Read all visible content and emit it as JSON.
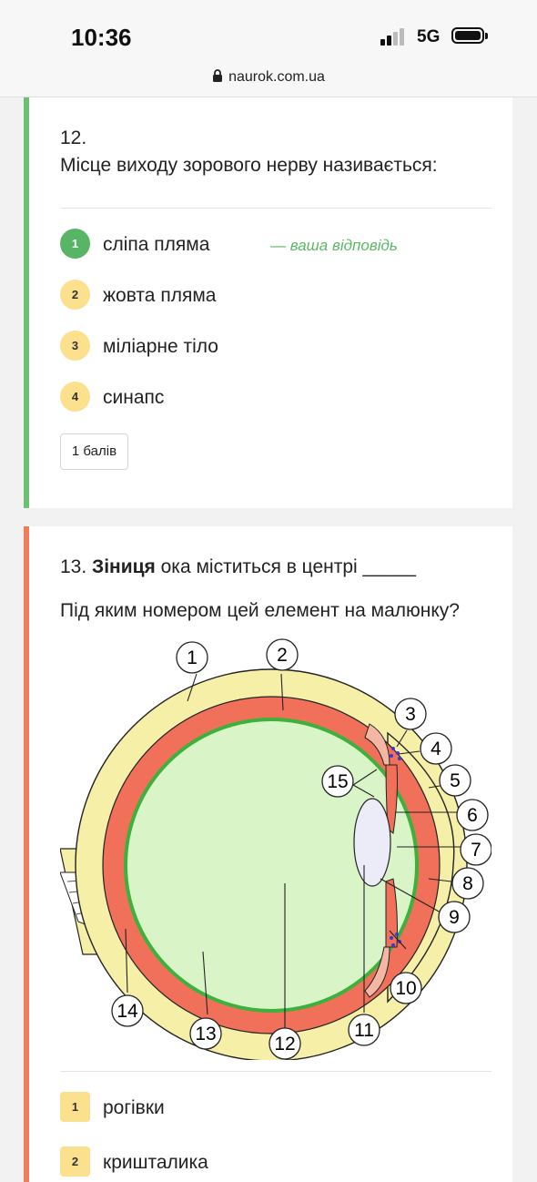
{
  "status_bar": {
    "time": "10:36",
    "network": "5G"
  },
  "browser": {
    "url": "naurok.com.ua"
  },
  "question12": {
    "number": "12.",
    "text": "Місце виходу зорового нерву називається:",
    "options": [
      {
        "n": "1",
        "label": "сліпа пляма"
      },
      {
        "n": "2",
        "label": "жовта пляма"
      },
      {
        "n": "3",
        "label": "міліарне тіло"
      },
      {
        "n": "4",
        "label": "синапс"
      }
    ],
    "your_answer_note": "— ваша відповідь",
    "points": "1 балів",
    "colors": {
      "accent": "#6cc173",
      "correct_badge": "#58b565",
      "hint": "#5cb865"
    }
  },
  "question13": {
    "number": "13.",
    "keyword": "Зіниця",
    "text_rest": " ока міститься в центрі _____",
    "subtext": "Під яким номером цей елемент на малюнку?",
    "diagram_labels": [
      "1",
      "2",
      "3",
      "4",
      "5",
      "6",
      "7",
      "8",
      "9",
      "10",
      "11",
      "12",
      "13",
      "14",
      "15"
    ],
    "options": [
      {
        "n": "1",
        "label": "рогівки"
      },
      {
        "n": "2",
        "label": "кришталика"
      }
    ],
    "colors": {
      "accent": "#f07c5b",
      "option_badge": "#fbe08e"
    }
  }
}
